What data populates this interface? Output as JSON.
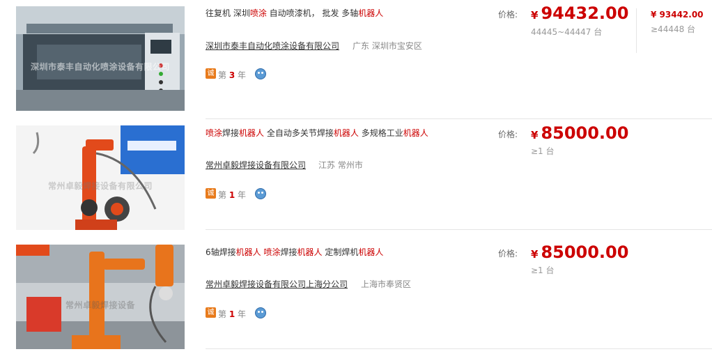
{
  "listings": [
    {
      "image": {
        "alt": "spraying-machine-photo",
        "watermark": "深圳市泰丰自动化喷涂设备有限公司"
      },
      "title_parts": [
        {
          "text": "往复机  深圳",
          "highlight": false
        },
        {
          "text": "喷涂",
          "highlight": true
        },
        {
          "text": " 自动喷漆机，  批发  多轴",
          "highlight": false
        },
        {
          "text": "机器人",
          "highlight": true
        }
      ],
      "company": "深圳市泰丰自动化喷涂设备有限公司",
      "location": "广东 深圳市宝安区",
      "cheng_badge": "诚",
      "years_prefix": "第",
      "years_num": "3",
      "years_suffix": "年",
      "price_label": "价格:",
      "currency": "¥",
      "price": "94432.00",
      "moq": "44445~44447 台",
      "tier_price": "¥ 93442.00",
      "tier_moq": "≥44448 台"
    },
    {
      "image": {
        "alt": "welding-robot-photo",
        "watermark": "常州卓毅焊接设备有限公司"
      },
      "title_parts": [
        {
          "text": "喷涂",
          "highlight": true
        },
        {
          "text": "焊接",
          "highlight": false
        },
        {
          "text": "机器人",
          "highlight": true
        },
        {
          "text": "  全自动多关节焊接",
          "highlight": false
        },
        {
          "text": "机器人",
          "highlight": true
        },
        {
          "text": "  多规格工业",
          "highlight": false
        },
        {
          "text": "机器人",
          "highlight": true
        }
      ],
      "company": "常州卓毅焊接设备有限公司",
      "location": "江苏 常州市",
      "cheng_badge": "诚",
      "years_prefix": "第",
      "years_num": "1",
      "years_suffix": "年",
      "price_label": "价格:",
      "currency": "¥",
      "price": "85000.00",
      "moq": "≥1 台"
    },
    {
      "image": {
        "alt": "welding-robot-factory-photo",
        "watermark": "常州卓毅焊接设备"
      },
      "title_parts": [
        {
          "text": "6轴焊接",
          "highlight": false
        },
        {
          "text": "机器人",
          "highlight": true
        },
        {
          "text": "  ",
          "highlight": false
        },
        {
          "text": "喷涂",
          "highlight": true
        },
        {
          "text": "焊接",
          "highlight": false
        },
        {
          "text": "机器人",
          "highlight": true
        },
        {
          "text": "  定制焊机",
          "highlight": false
        },
        {
          "text": "机器人",
          "highlight": true
        }
      ],
      "company": "常州卓毅焊接设备有限公司上海分公司",
      "location": "上海市奉贤区",
      "cheng_badge": "诚",
      "years_prefix": "第",
      "years_num": "1",
      "years_suffix": "年",
      "price_label": "价格:",
      "currency": "¥",
      "price": "85000.00",
      "moq": "≥1 台"
    }
  ],
  "colors": {
    "accent_red": "#cc0000",
    "badge_orange": "#e87b1c"
  }
}
